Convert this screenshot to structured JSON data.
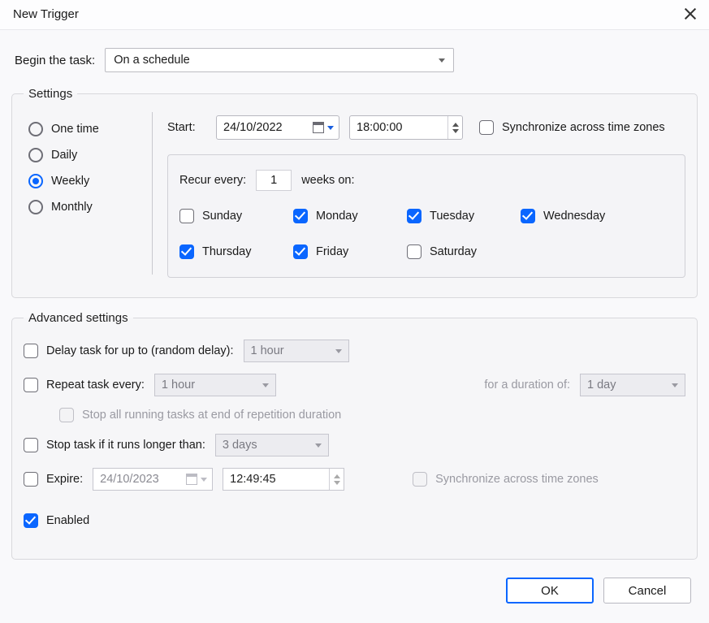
{
  "window": {
    "title": "New Trigger"
  },
  "begin": {
    "label": "Begin the task:",
    "value": "On a schedule"
  },
  "settings": {
    "legend": "Settings",
    "frequency": {
      "options": [
        "One time",
        "Daily",
        "Weekly",
        "Monthly"
      ],
      "selected": "Weekly"
    },
    "start_label": "Start:",
    "start_date": "24/10/2022",
    "start_time": "18:00:00",
    "sync_label": "Synchronize across time zones",
    "sync_checked": false,
    "recur": {
      "prefix": "Recur every:",
      "value": "1",
      "suffix": "weeks on:",
      "days": [
        {
          "name": "Sunday",
          "checked": false
        },
        {
          "name": "Monday",
          "checked": true
        },
        {
          "name": "Tuesday",
          "checked": true
        },
        {
          "name": "Wednesday",
          "checked": true
        },
        {
          "name": "Thursday",
          "checked": true
        },
        {
          "name": "Friday",
          "checked": true
        },
        {
          "name": "Saturday",
          "checked": false
        }
      ]
    }
  },
  "advanced": {
    "legend": "Advanced settings",
    "delay_label": "Delay task for up to (random delay):",
    "delay_value": "1 hour",
    "delay_checked": false,
    "repeat_label": "Repeat task every:",
    "repeat_value": "1 hour",
    "repeat_checked": false,
    "duration_label": "for a duration of:",
    "duration_value": "1 day",
    "stop_all_label": "Stop all running tasks at end of repetition duration",
    "stop_label": "Stop task if it runs longer than:",
    "stop_value": "3 days",
    "stop_checked": false,
    "expire_label": "Expire:",
    "expire_date": "24/10/2023",
    "expire_time": "12:49:45",
    "expire_checked": false,
    "expire_sync_label": "Synchronize across time zones",
    "enabled_label": "Enabled",
    "enabled_checked": true
  },
  "buttons": {
    "ok": "OK",
    "cancel": "Cancel"
  }
}
